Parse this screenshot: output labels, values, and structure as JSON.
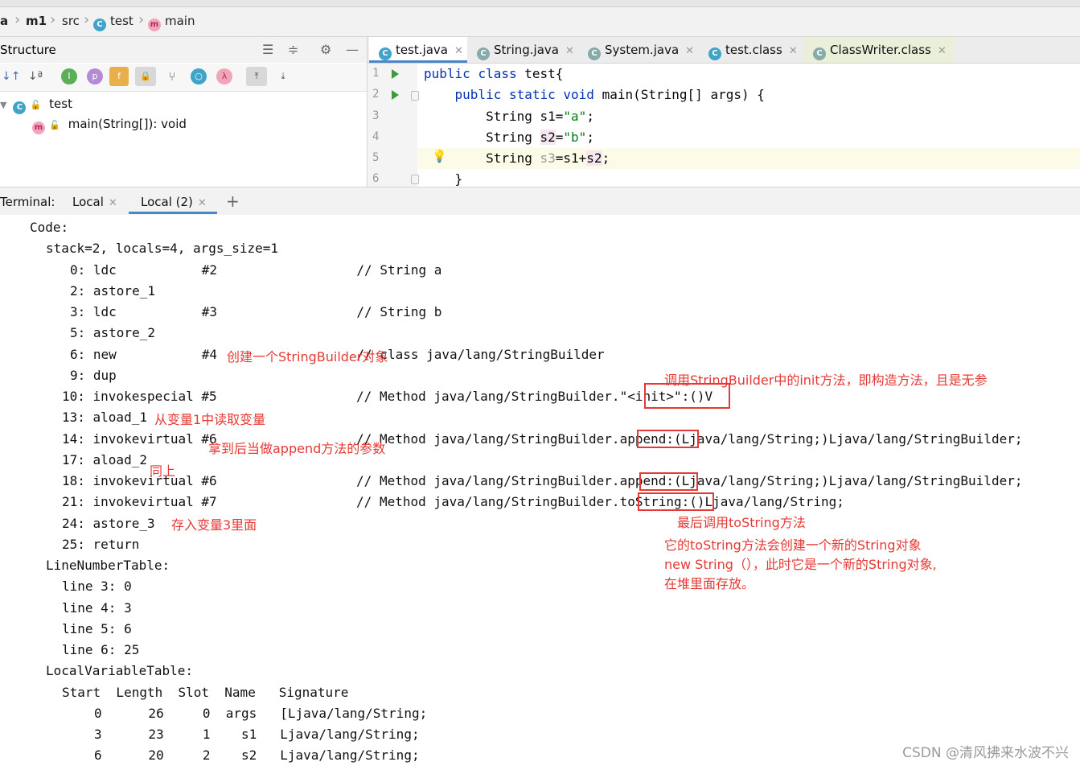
{
  "breadcrumb": {
    "items": [
      "a",
      "m1",
      "src",
      "test",
      "main"
    ]
  },
  "structure": {
    "title": "Structure",
    "tree": [
      {
        "label": "test"
      },
      {
        "label": "main(String[]): void"
      }
    ]
  },
  "editor": {
    "tabs": [
      {
        "label": "test.java",
        "active": true
      },
      {
        "label": "String.java"
      },
      {
        "label": "System.java"
      },
      {
        "label": "test.class"
      },
      {
        "label": "ClassWriter.class"
      }
    ],
    "line_numbers": [
      "1",
      "2",
      "3",
      "4",
      "5",
      "6"
    ],
    "code": {
      "l1_kw1": "public",
      "l1_kw2": "class",
      "l1_rest": "test{",
      "l2_kw1": "public",
      "l2_kw2": "static",
      "l2_kw3": "void",
      "l2_rest": "main(String[] args) {",
      "l3_type": "String",
      "l3_var": "s1",
      "l3_eq": "=",
      "l3_str": "\"a\"",
      "l3_end": ";",
      "l4_type": "String",
      "l4_var": "s2",
      "l4_eq": "=",
      "l4_str": "\"b\"",
      "l4_end": ";",
      "l5_type": "String",
      "l5_var": "s3",
      "l5_mid": "=s1+",
      "l5_var2": "s2",
      "l5_end": ";",
      "l6": "}"
    }
  },
  "terminal": {
    "label": "Terminal:",
    "tabs": [
      {
        "label": "Local"
      },
      {
        "label": "Local (2)",
        "active": true
      }
    ],
    "add": "+",
    "lines": [
      "Code:",
      "stack=2, locals=4, args_size=1",
      "0: ldc           #2                  // String a",
      "2: astore_1",
      "3: ldc           #3                  // String b",
      "5: astore_2",
      "6: new           #4                  // class java/lang/StringBuilder",
      "9: dup",
      "10: invokespecial #5                  // Method java/lang/StringBuilder.\"<init>\":()V",
      "13: aload_1",
      "14: invokevirtual #6                  // Method java/lang/StringBuilder.append:(Ljava/lang/String;)Ljava/lang/StringBuilder;",
      "17: aload_2",
      "18: invokevirtual #6                  // Method java/lang/StringBuilder.append:(Ljava/lang/String;)Ljava/lang/StringBuilder;",
      "21: invokevirtual #7                  // Method java/lang/StringBuilder.toString:()Ljava/lang/String;",
      "24: astore_3",
      "25: return",
      "LineNumberTable:",
      "line 3: 0",
      "line 4: 3",
      "line 5: 6",
      "line 6: 25",
      "LocalVariableTable:",
      "Start  Length  Slot  Name   Signature",
      "0      26     0  args   [Ljava/lang/String;",
      "3      23     1    s1   Ljava/lang/String;",
      "6      20     2    s2   Ljava/lang/String;"
    ]
  },
  "annotations": {
    "new_sb": "创建一个StringBuilder对象",
    "init": "调用StringBuilder中的init方法，即构造方法，且是无参",
    "aload1": "从变量1中读取变量",
    "append_param": "拿到后当做append方法的参数",
    "same": "同上",
    "store3": "存入变量3里面",
    "tostring": "最后调用toString方法",
    "tostring_desc1": "它的toString方法会创建一个新的String对象",
    "tostring_desc2": "new String（），此时它是一个新的String对象,",
    "tostring_desc3": "在堆里面存放。"
  },
  "watermark": "CSDN @清风拂来水波不兴",
  "colors": {
    "annotation": "#e53935",
    "keyword": "#0033b3",
    "string": "#067d17",
    "active_tab": "#4a86c8"
  }
}
